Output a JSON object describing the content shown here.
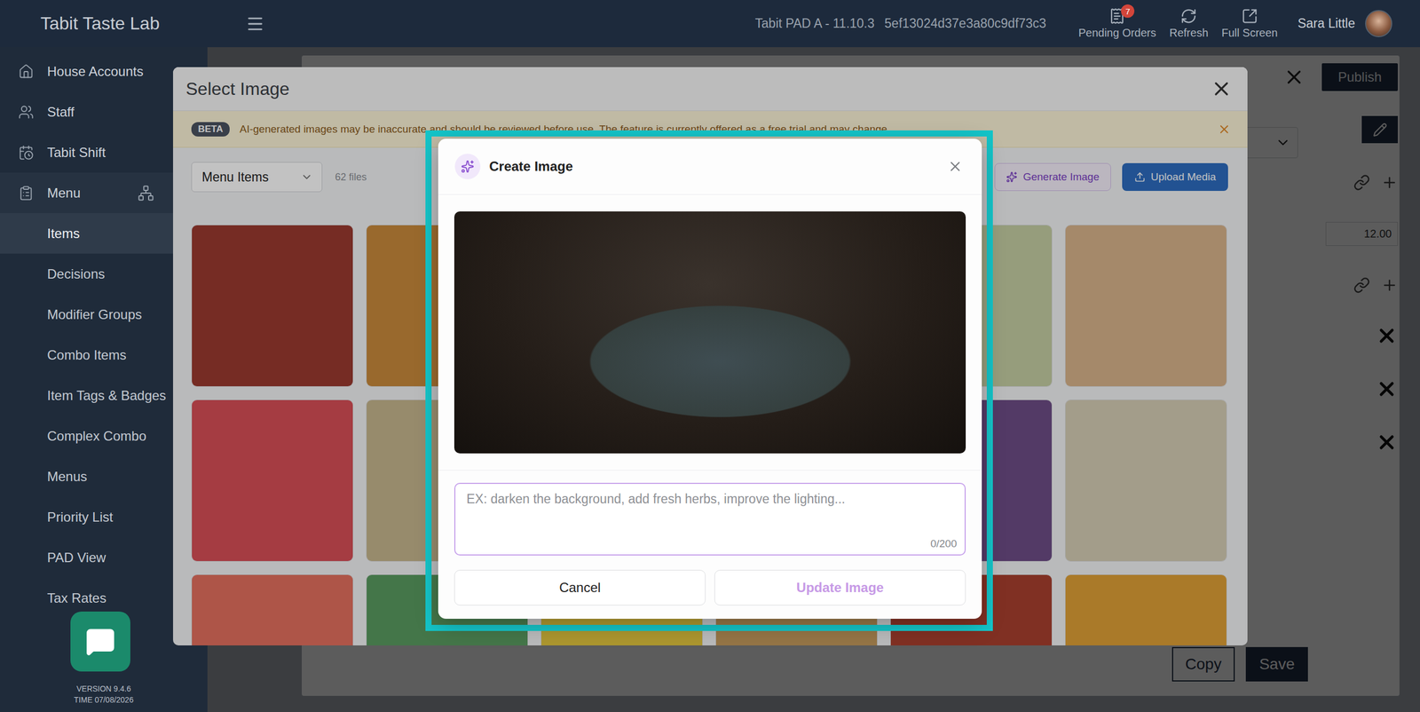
{
  "top_bar": {
    "brand": "Tabit Taste Lab",
    "device": "Tabit PAD A - 11.10.3",
    "device_id": "5ef13024d37e3a80c9df73c3",
    "actions": [
      {
        "label": "Pending Orders",
        "badge": "7"
      },
      {
        "label": "Refresh",
        "badge": ""
      },
      {
        "label": "Full Screen",
        "badge": ""
      }
    ],
    "user": "Sara Little"
  },
  "sidebar": {
    "items": [
      {
        "label": "House Accounts",
        "kind": "section",
        "selected": false,
        "expanded": false
      },
      {
        "label": "Staff",
        "kind": "section",
        "selected": false,
        "expanded": false
      },
      {
        "label": "Tabit Shift",
        "kind": "section",
        "selected": false,
        "expanded": false
      },
      {
        "label": "Menu",
        "kind": "section",
        "selected": false,
        "expanded": true
      },
      {
        "label": "Items",
        "kind": "sub",
        "selected": true,
        "expanded": false
      },
      {
        "label": "Decisions",
        "kind": "sub",
        "selected": false,
        "expanded": false
      },
      {
        "label": "Modifier Groups",
        "kind": "sub",
        "selected": false,
        "expanded": false
      },
      {
        "label": "Combo Items",
        "kind": "sub",
        "selected": false,
        "expanded": false
      },
      {
        "label": "Item Tags & Badges",
        "kind": "sub",
        "selected": false,
        "expanded": false
      },
      {
        "label": "Complex Combo",
        "kind": "sub",
        "selected": false,
        "expanded": false
      },
      {
        "label": "Menus",
        "kind": "sub",
        "selected": false,
        "expanded": false
      },
      {
        "label": "Priority List",
        "kind": "sub",
        "selected": false,
        "expanded": false
      },
      {
        "label": "PAD View",
        "kind": "sub",
        "selected": false,
        "expanded": false
      },
      {
        "label": "Tax Rates",
        "kind": "sub",
        "selected": false,
        "expanded": false
      }
    ],
    "version": "VERSION 9.4.6",
    "time": "TIME 07/08/2026"
  },
  "background_page": {
    "publish": "Publish",
    "price": "12.00",
    "copy": "Copy",
    "save": "Save"
  },
  "select_image": {
    "title": "Select Image",
    "beta_badge": "BETA",
    "beta_text": "AI-generated images may be inaccurate and should be reviewed before use. The feature is currently offered as a free trial and may change.",
    "folder": "Menu Items",
    "file_count": "62 files",
    "generate_button": "Generate Image",
    "upload_button": "Upload Media",
    "tiles": [
      {
        "color": "#9c3a30"
      },
      {
        "color": "#c98a3c"
      },
      {
        "color": "#b58a5e"
      },
      {
        "color": "#a88660"
      },
      {
        "color": "#c5cfa4"
      },
      {
        "color": "#d9b58c"
      },
      {
        "color": "#d94f57"
      },
      {
        "color": "#c7b78f"
      },
      {
        "color": "#a9875e"
      },
      {
        "color": "#8c6a4a"
      },
      {
        "color": "#6d4d86"
      },
      {
        "color": "#d6cfb6"
      },
      {
        "color": "#e5705f"
      },
      {
        "color": "#5a9b60"
      },
      {
        "color": "#e3c53f"
      },
      {
        "color": "#c49a5c"
      },
      {
        "color": "#a9402f"
      },
      {
        "color": "#e0a136"
      }
    ]
  },
  "create_image": {
    "title": "Create Image",
    "prompt": {
      "placeholder": "EX: darken the background, add fresh herbs, improve the lighting...",
      "value": "",
      "counter": "0/200"
    },
    "buttons": [
      {
        "label": "Cancel",
        "kind": "secondary",
        "disabled": false
      },
      {
        "label": "Update Image",
        "kind": "primary",
        "disabled": true
      }
    ]
  }
}
